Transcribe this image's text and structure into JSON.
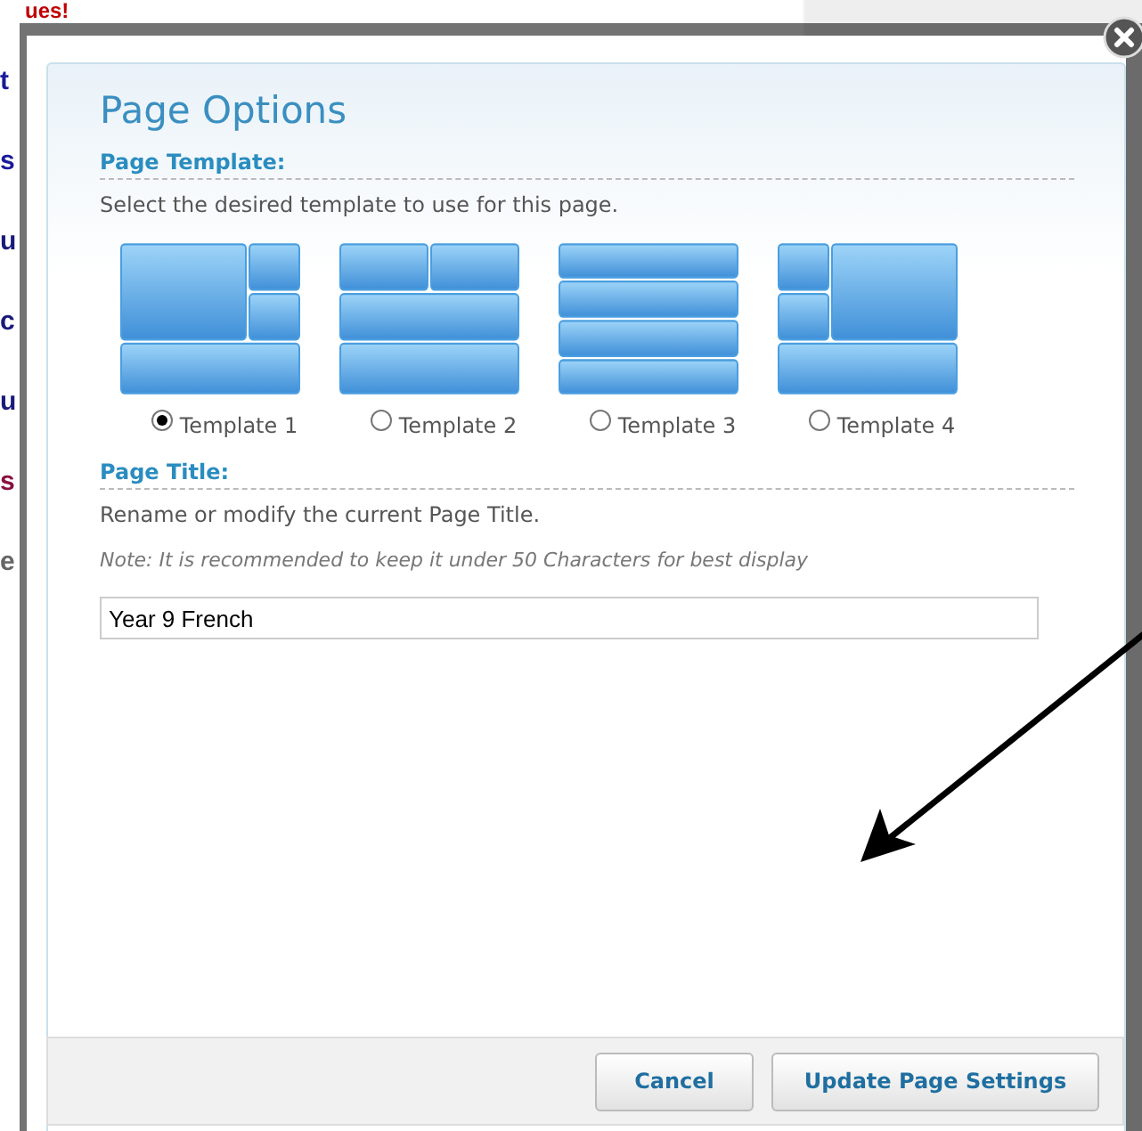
{
  "background_page": {
    "heading": "ues!",
    "edge_letters": [
      {
        "text": "t",
        "color": "#1a1a9a"
      },
      {
        "text": "s",
        "color": "#1a1a9a"
      },
      {
        "text": "u",
        "color": "#1a1a7a"
      },
      {
        "text": "c",
        "color": "#1a1a7a"
      },
      {
        "text": "u",
        "color": "#1a1a7a"
      },
      {
        "text": "s",
        "color": "#8a1040"
      },
      {
        "text": "e",
        "color": "#666666"
      }
    ]
  },
  "dialog": {
    "title": "Page Options",
    "template_section": {
      "heading": "Page Template:",
      "description": "Select the desired template to use for this page.",
      "templates": [
        {
          "kind": "big-left",
          "label": "Template 1",
          "selected": true
        },
        {
          "kind": "two-top",
          "label": "Template 2",
          "selected": false
        },
        {
          "kind": "four-rows",
          "label": "Template 3",
          "selected": false
        },
        {
          "kind": "big-right",
          "label": "Template 4",
          "selected": false
        }
      ]
    },
    "title_section": {
      "heading": "Page Title:",
      "description": "Rename or modify the current Page Title.",
      "note": "Note: It is recommended to keep it under 50 Characters for best display",
      "value": "Year 9 French"
    },
    "buttons": [
      {
        "label": "Cancel"
      },
      {
        "label": "Update Page Settings"
      }
    ]
  }
}
